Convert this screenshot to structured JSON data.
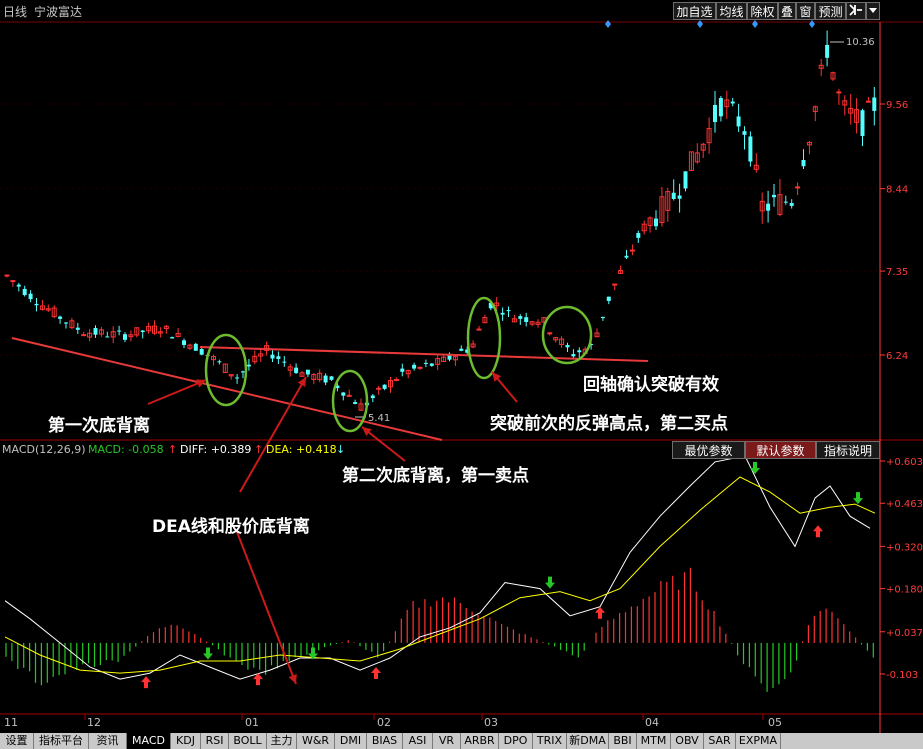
{
  "window": {
    "period": "日线",
    "stock_name": "宁波富达",
    "toolbar": [
      "加自选",
      "均线",
      "除权",
      "叠",
      "窗",
      "预测"
    ],
    "toolbar_icons": [
      "pin-icon",
      "dropdown-icon"
    ]
  },
  "price_panel": {
    "axis_ticks": [
      "9.56",
      "8.44",
      "7.35",
      "6.24"
    ],
    "axis_color": "#ff3c3c",
    "high_label": "10.36",
    "low_label": "5.41",
    "up_color": "#ff3232",
    "down_color": "#54ffff"
  },
  "macd_panel": {
    "indicator": "MACD(12,26,9)",
    "macd_label": "MACD: -0.058",
    "macd_color": "#26c826",
    "diff_label": "DIFF: +0.389",
    "diff_color": "#ffffff",
    "dea_label": "DEA: +0.418",
    "dea_color": "#ffff00",
    "buttons": [
      "最优参数",
      "默认参数",
      "指标说明"
    ],
    "axis_ticks": [
      "+0.603",
      "+0.463",
      "+0.320",
      "+0.180",
      "+0.037",
      "-0.103"
    ]
  },
  "annotations": {
    "first_bottom": "第一次底背离",
    "second_bottom": "第二次底背离，第一卖点",
    "dea_divergence": "DEA线和股价底背离",
    "breakthrough": "突破前次的反弹高点，第二买点",
    "pullback": "回轴确认突破有效"
  },
  "time_axis": [
    "11",
    "12",
    "01",
    "02",
    "03",
    "04",
    "05"
  ],
  "tabs": [
    "设置",
    "指标平台",
    "资讯",
    "MACD",
    "KDJ",
    "RSI",
    "BOLL",
    "主力",
    "W&R",
    "DMI",
    "BIAS",
    "ASI",
    "VR",
    "ARBR",
    "DPO",
    "TRIX",
    "新DMA",
    "BBI",
    "MTM",
    "OBV",
    "SAR",
    "EXPMA"
  ],
  "active_tab": "MACD"
}
